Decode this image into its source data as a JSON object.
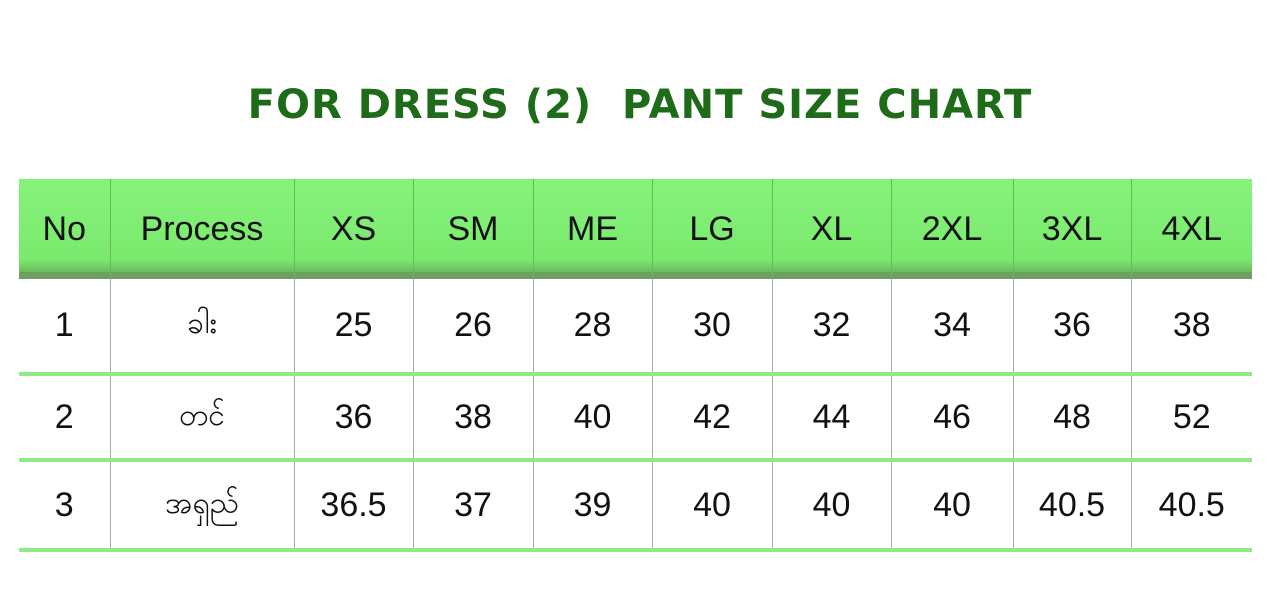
{
  "title": "FOR DRESS (2)  PANT SIZE CHART",
  "table": {
    "headers": [
      "No",
      "Process",
      "XS",
      "SM",
      "ME",
      "LG",
      "XL",
      "2XL",
      "3XL",
      "4XL"
    ],
    "rows": [
      [
        "1",
        "ခါး",
        "25",
        "26",
        "28",
        "30",
        "32",
        "34",
        "36",
        "38"
      ],
      [
        "2",
        "တင်",
        "36",
        "38",
        "40",
        "42",
        "44",
        "46",
        "48",
        "52"
      ],
      [
        "3",
        "အရှည်",
        "36.5",
        "37",
        "39",
        "40",
        "40",
        "40",
        "40.5",
        "40.5"
      ]
    ]
  },
  "colors": {
    "title": "#1e6b19",
    "header_bg": "#7aea6e",
    "row_divider": "#8deb82"
  }
}
